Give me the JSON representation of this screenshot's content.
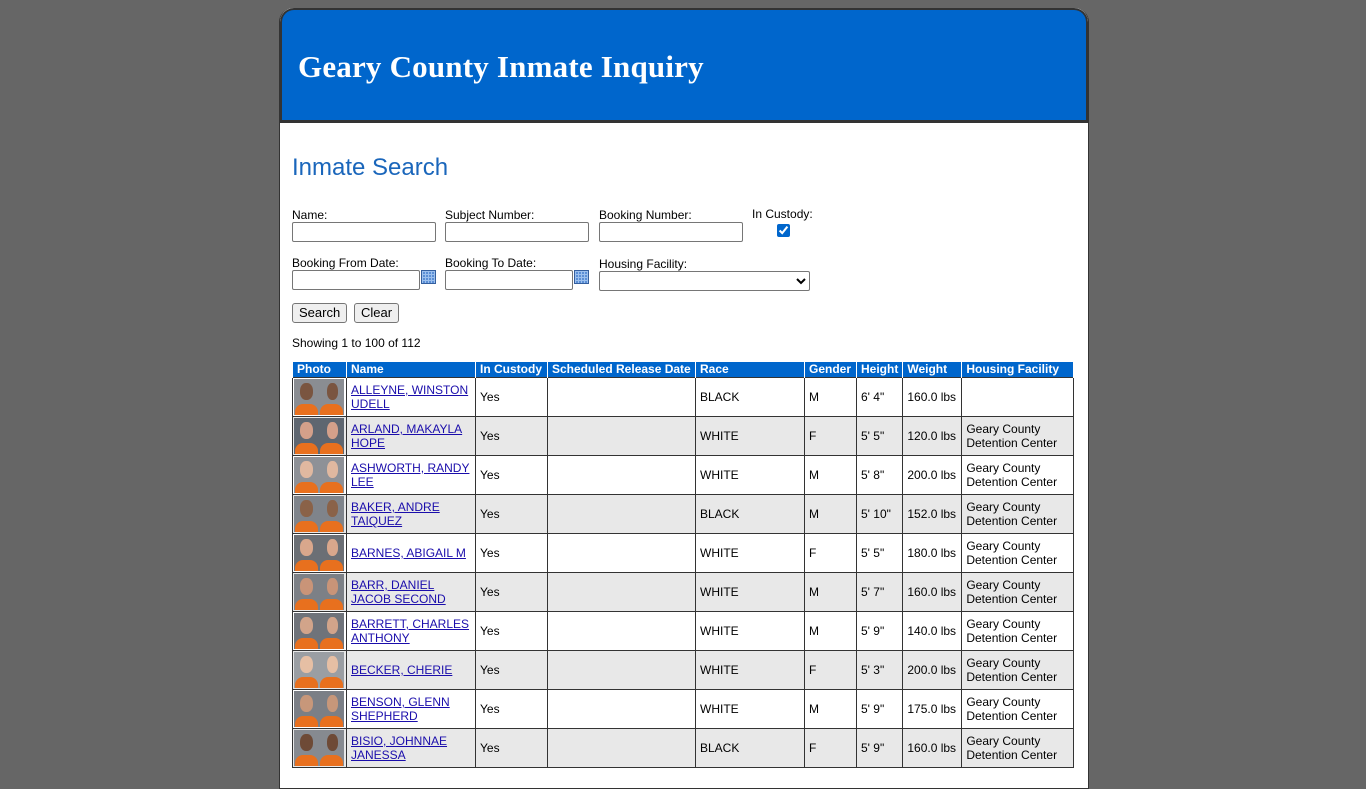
{
  "header": {
    "title": "Geary County Inmate Inquiry"
  },
  "search": {
    "title": "Inmate Search",
    "name_label": "Name:",
    "subject_label": "Subject Number:",
    "booking_label": "Booking Number:",
    "custody_label": "In Custody:",
    "from_label": "Booking From Date:",
    "to_label": "Booking To Date:",
    "facility_label": "Housing Facility:",
    "search_button": "Search",
    "clear_button": "Clear"
  },
  "results": {
    "showing": "Showing 1 to 100 of 112",
    "columns": [
      "Photo",
      "Name",
      "In Custody",
      "Scheduled Release Date",
      "Race",
      "Gender",
      "Height",
      "Weight",
      "Housing Facility"
    ],
    "rows": [
      {
        "name": "ALLEYNE, WINSTON UDELL",
        "custody": "Yes",
        "release": "",
        "race": "BLACK",
        "gender": "M",
        "height": "6' 4\"",
        "weight": "160.0 lbs",
        "facility": ""
      },
      {
        "name": "ARLAND, MAKAYLA HOPE",
        "custody": "Yes",
        "release": "",
        "race": "WHITE",
        "gender": "F",
        "height": "5' 5\"",
        "weight": "120.0 lbs",
        "facility": "Geary County Detention Center"
      },
      {
        "name": "ASHWORTH, RANDY LEE",
        "custody": "Yes",
        "release": "",
        "race": "WHITE",
        "gender": "M",
        "height": "5' 8\"",
        "weight": "200.0 lbs",
        "facility": "Geary County Detention Center"
      },
      {
        "name": "BAKER, ANDRE TAIQUEZ",
        "custody": "Yes",
        "release": "",
        "race": "BLACK",
        "gender": "M",
        "height": "5' 10\"",
        "weight": "152.0 lbs",
        "facility": "Geary County Detention Center"
      },
      {
        "name": "BARNES, ABIGAIL M",
        "custody": "Yes",
        "release": "",
        "race": "WHITE",
        "gender": "F",
        "height": "5' 5\"",
        "weight": "180.0 lbs",
        "facility": "Geary County Detention Center"
      },
      {
        "name": "BARR, DANIEL JACOB SECOND",
        "custody": "Yes",
        "release": "",
        "race": "WHITE",
        "gender": "M",
        "height": "5' 7\"",
        "weight": "160.0 lbs",
        "facility": "Geary County Detention Center"
      },
      {
        "name": "BARRETT, CHARLES ANTHONY",
        "custody": "Yes",
        "release": "",
        "race": "WHITE",
        "gender": "M",
        "height": "5' 9\"",
        "weight": "140.0 lbs",
        "facility": "Geary County Detention Center"
      },
      {
        "name": "BECKER, CHERIE",
        "custody": "Yes",
        "release": "",
        "race": "WHITE",
        "gender": "F",
        "height": "5' 3\"",
        "weight": "200.0 lbs",
        "facility": "Geary County Detention Center"
      },
      {
        "name": "BENSON, GLENN SHEPHERD",
        "custody": "Yes",
        "release": "",
        "race": "WHITE",
        "gender": "M",
        "height": "5' 9\"",
        "weight": "175.0 lbs",
        "facility": "Geary County Detention Center"
      },
      {
        "name": "BISIO, JOHNNAE JANESSA",
        "custody": "Yes",
        "release": "",
        "race": "BLACK",
        "gender": "F",
        "height": "5' 9\"",
        "weight": "160.0 lbs",
        "facility": "Geary County Detention Center"
      }
    ]
  },
  "colors": {
    "brand": "#0066cc",
    "background": "#666666",
    "row_alt": "#e8e8e8"
  }
}
